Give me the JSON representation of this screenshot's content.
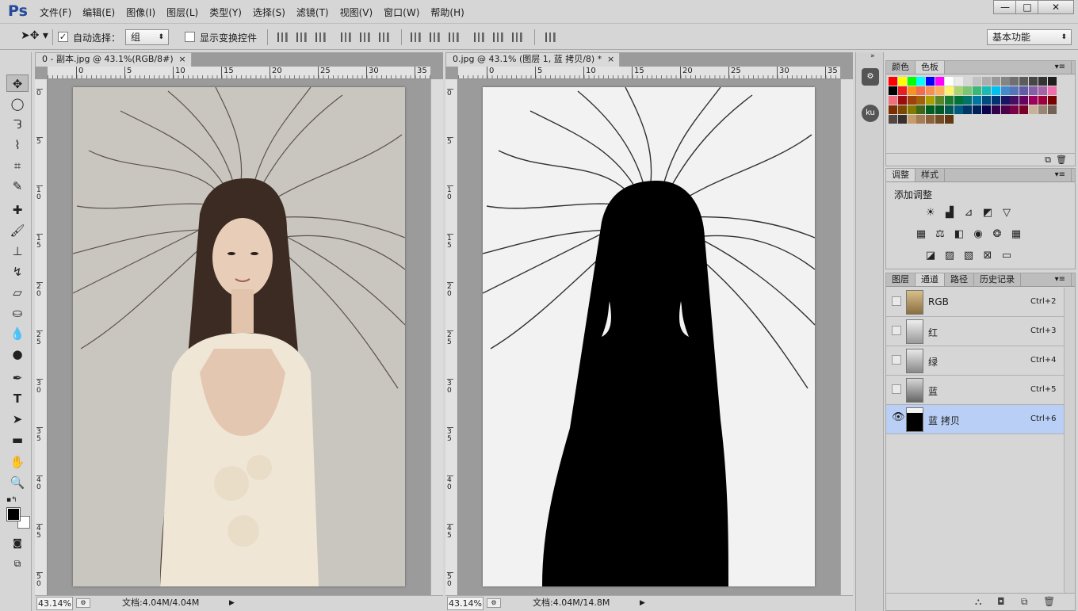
{
  "app": {
    "logo": "Ps"
  },
  "menu": [
    "文件(F)",
    "编辑(E)",
    "图像(I)",
    "图层(L)",
    "类型(Y)",
    "选择(S)",
    "滤镜(T)",
    "视图(V)",
    "窗口(W)",
    "帮助(H)"
  ],
  "window_buttons": {
    "minimize": "—",
    "restore": "□",
    "close": "✕"
  },
  "options": {
    "auto_select_label": "自动选择：",
    "auto_select_checked": "✓",
    "auto_select_value": "组",
    "show_transform_label": "显示变换控件",
    "workspace": "基本功能"
  },
  "documents": [
    {
      "tab": "0 - 副本.jpg @ 43.1%(RGB/8#)",
      "zoom": "43.14%",
      "doc_info": "文档:4.04M/4.04M",
      "ruler_ticks": [
        "0",
        "5",
        "10",
        "15",
        "20",
        "25",
        "30",
        "35"
      ],
      "vruler_ticks": [
        "0",
        "5",
        "10",
        "15",
        "20",
        "25",
        "30",
        "35",
        "40",
        "45",
        "50"
      ]
    },
    {
      "tab": "0.jpg @ 43.1% (图层 1, 蓝 拷贝/8) *",
      "zoom": "43.14%",
      "doc_info": "文档:4.04M/14.8M",
      "ruler_ticks": [
        "0",
        "5",
        "10",
        "15",
        "20",
        "25",
        "30",
        "35"
      ],
      "vruler_ticks": [
        "0",
        "5",
        "10",
        "15",
        "20",
        "25",
        "30",
        "35",
        "40",
        "45",
        "50"
      ]
    }
  ],
  "panels": {
    "color_tabs": [
      "颜色",
      "色板"
    ],
    "adjust_tabs": [
      "调整",
      "样式"
    ],
    "adjust_title": "添加调整",
    "layers_tabs": [
      "图层",
      "通道",
      "路径",
      "历史记录"
    ],
    "channels": [
      {
        "name": "RGB",
        "shortcut": "Ctrl+2",
        "visible": false,
        "selected": false
      },
      {
        "name": "红",
        "shortcut": "Ctrl+3",
        "visible": false,
        "selected": false
      },
      {
        "name": "绿",
        "shortcut": "Ctrl+4",
        "visible": false,
        "selected": false
      },
      {
        "name": "蓝",
        "shortcut": "Ctrl+5",
        "visible": false,
        "selected": false
      },
      {
        "name": "蓝 拷贝",
        "shortcut": "Ctrl+6",
        "visible": true,
        "selected": true
      }
    ]
  },
  "dock_icons": [
    "adjust-panel-icon",
    "ku-icon"
  ],
  "dock_ku_label": "ku",
  "swatch_colors": [
    "#ff0000",
    "#ffff00",
    "#00ff00",
    "#00ffff",
    "#0000ff",
    "#ff00ff",
    "#ffffff",
    "#ebebeb",
    "#d6d6d6",
    "#c2c2c2",
    "#adadad",
    "#999999",
    "#858585",
    "#707070",
    "#5c5c5c",
    "#474747",
    "#333333",
    "#1f1f1f",
    "#000000",
    "#ed1c24",
    "#f7941d"
  ],
  "accent": "#b9cff5"
}
